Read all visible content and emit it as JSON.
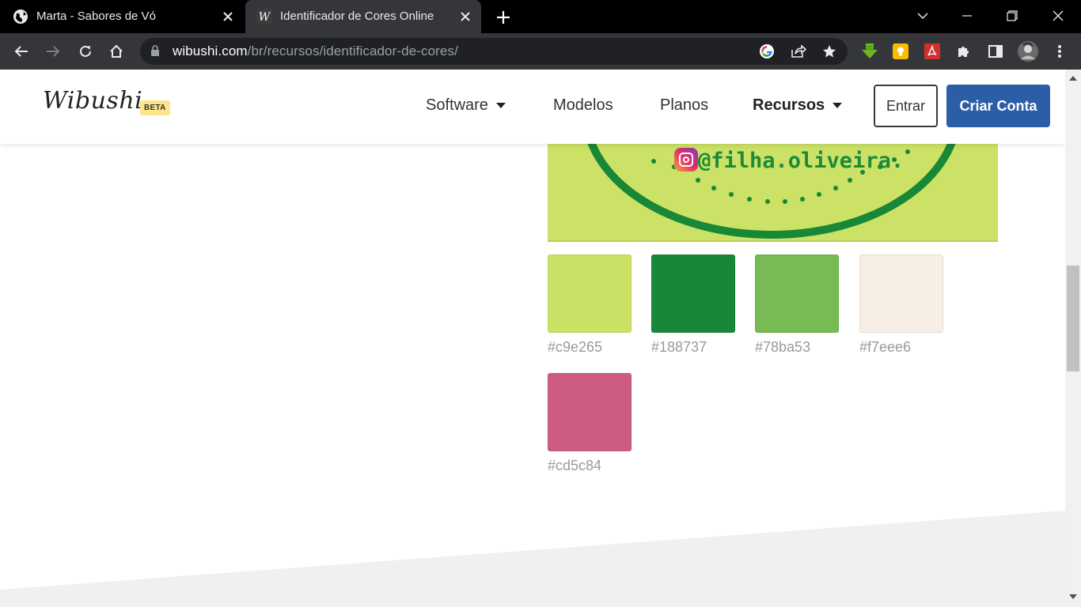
{
  "browser": {
    "tabs": [
      {
        "title": "Marta - Sabores de Vó",
        "active": false,
        "favicon": "globe-icon"
      },
      {
        "title": "Identificador de Cores Online",
        "active": true,
        "favicon": "wibushi-w-icon"
      }
    ],
    "url_host": "wibushi.com",
    "url_path": "/br/recursos/identificador-de-cores/"
  },
  "site": {
    "logo": "Wibushi",
    "beta": "BETA",
    "nav": [
      {
        "label": "Software",
        "dropdown": true
      },
      {
        "label": "Modelos",
        "dropdown": false
      },
      {
        "label": "Planos",
        "dropdown": false
      },
      {
        "label": "Recursos",
        "dropdown": true,
        "active": true
      }
    ],
    "login_label": "Entrar",
    "signup_label": "Criar Conta"
  },
  "uploaded_image": {
    "instagram_handle": "@filha.oliveira."
  },
  "palette": [
    {
      "hex": "#c9e265"
    },
    {
      "hex": "#188737"
    },
    {
      "hex": "#78ba53"
    },
    {
      "hex": "#f7eee6"
    },
    {
      "hex": "#cd5c84"
    }
  ],
  "colors": {
    "brand_blue": "#2c5ea8",
    "beta_yellow": "#fde58a",
    "footer_gray": "#eef0f2"
  }
}
